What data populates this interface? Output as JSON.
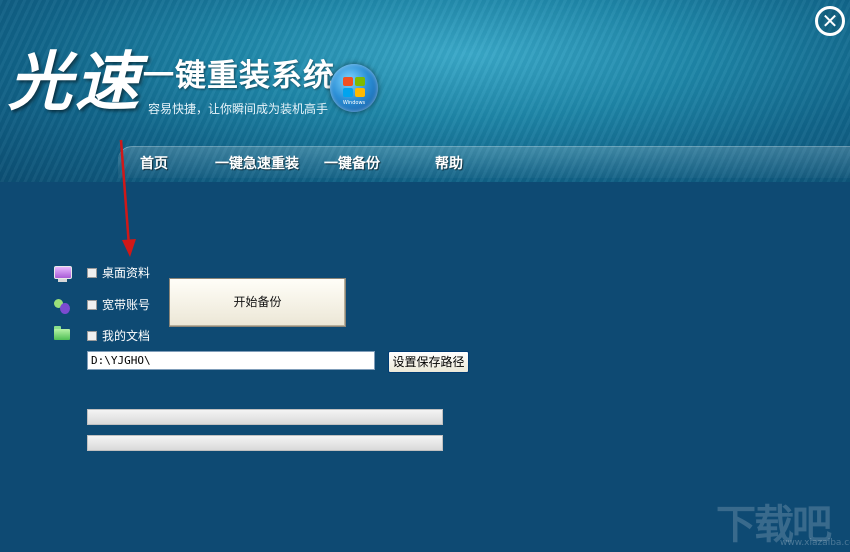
{
  "brand": {
    "char1": "光",
    "char2": "速",
    "title": "一键重装系统",
    "subtitle": "容易快捷，让你瞬间成为装机高手",
    "logo_text": "Windows"
  },
  "window": {
    "close_label": "✕"
  },
  "nav": {
    "home": "首页",
    "reinstall": "一键急速重装",
    "backup": "一键备份",
    "help": "帮助"
  },
  "backup_options": {
    "items": [
      {
        "label": "桌面资料",
        "icon": "desktop-icon",
        "checked": false
      },
      {
        "label": "宽带账号",
        "icon": "broadband-user-icon",
        "checked": false
      },
      {
        "label": "我的文档",
        "icon": "folder-icon",
        "checked": false
      }
    ]
  },
  "actions": {
    "start_backup": "开始备份",
    "set_path": "设置保存路径"
  },
  "path": {
    "value": "D:\\YJGHO\\"
  },
  "progress": {
    "bar1": 0,
    "bar2": 0
  },
  "watermark": {
    "text": "下载吧",
    "url": "www.xiazaiba.com"
  },
  "colors": {
    "background": "#0e4a73",
    "header": "#1e86a8",
    "arrow": "#d01818"
  }
}
